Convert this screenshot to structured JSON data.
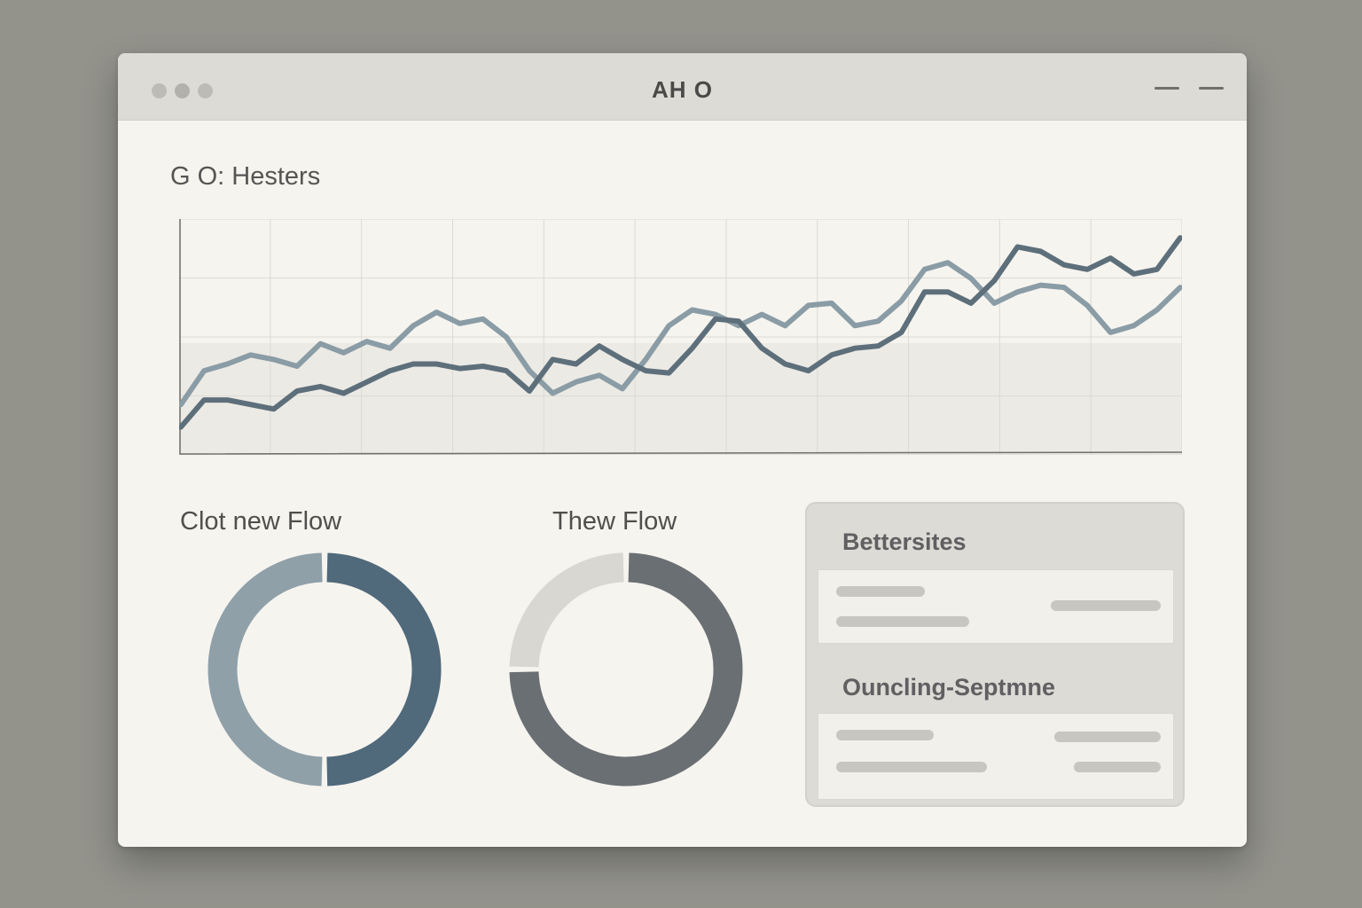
{
  "window": {
    "title": "AH O"
  },
  "main": {
    "section_title": "G O: Hesters",
    "donuts": [
      {
        "label": "Clot new Flow",
        "fraction": 0.5,
        "colors": [
          "#50697b",
          "#8fa0a9"
        ]
      },
      {
        "label": "Thew Flow",
        "fraction": 0.75,
        "colors": [
          "#6a6f73",
          "#d9d7d2"
        ]
      }
    ],
    "panel": {
      "sections": [
        {
          "heading": "Bettersites"
        },
        {
          "heading": "Ouncling-Septmne"
        }
      ]
    }
  },
  "chart_data": {
    "type": "line",
    "title": "",
    "xlabel": "",
    "ylabel": "",
    "grid": true,
    "x": [
      0,
      1,
      2,
      3,
      4,
      5,
      6,
      7,
      8,
      9,
      10,
      11,
      12,
      13,
      14,
      15,
      16,
      17,
      18,
      19,
      20,
      21,
      22,
      23,
      24,
      25,
      26,
      27,
      28,
      29,
      30,
      31,
      32,
      33,
      34,
      35,
      36,
      37,
      38,
      39,
      40,
      41,
      42,
      43
    ],
    "ylim": [
      0,
      100
    ],
    "series": [
      {
        "color": "#8a9ca5",
        "values": [
          20,
          35,
          38,
          42,
          40,
          37,
          47,
          43,
          48,
          45,
          55,
          61,
          56,
          58,
          50,
          35,
          25,
          30,
          33,
          27,
          40,
          55,
          62,
          60,
          55,
          60,
          55,
          64,
          65,
          55,
          57,
          66,
          80,
          83,
          76,
          65,
          70,
          73,
          72,
          64,
          52,
          55,
          62,
          72
        ]
      },
      {
        "color": "#5d6f7a",
        "values": [
          10,
          22,
          22,
          20,
          18,
          26,
          28,
          25,
          30,
          35,
          38,
          38,
          36,
          37,
          35,
          26,
          40,
          38,
          46,
          40,
          35,
          34,
          45,
          58,
          57,
          45,
          38,
          35,
          42,
          45,
          46,
          52,
          70,
          70,
          65,
          75,
          90,
          88,
          82,
          80,
          85,
          78,
          80,
          94
        ]
      }
    ]
  }
}
